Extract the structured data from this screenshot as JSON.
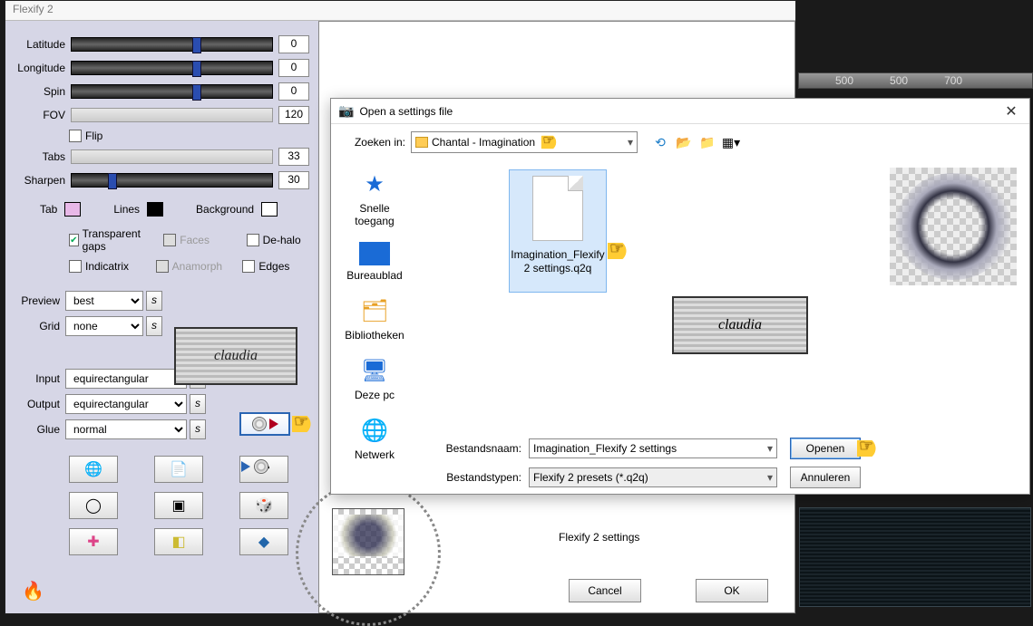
{
  "flexify": {
    "title": "Flexify 2",
    "sliders": {
      "latitude": {
        "label": "Latitude",
        "value": "0"
      },
      "longitude": {
        "label": "Longitude",
        "value": "0"
      },
      "spin": {
        "label": "Spin",
        "value": "0"
      },
      "fov": {
        "label": "FOV",
        "value": "120"
      },
      "tabs": {
        "label": "Tabs",
        "value": "33"
      },
      "sharpen": {
        "label": "Sharpen",
        "value": "30"
      }
    },
    "flip_label": "Flip",
    "swatches": {
      "tab": "Tab",
      "lines": "Lines",
      "background": "Background"
    },
    "checks": {
      "transparent": "Transparent gaps",
      "faces": "Faces",
      "dehalo": "De-halo",
      "indicatrix": "Indicatrix",
      "anamorph": "Anamorph",
      "edges": "Edges"
    },
    "selects": {
      "preview": {
        "label": "Preview",
        "value": "best"
      },
      "grid": {
        "label": "Grid",
        "value": "none"
      },
      "input": {
        "label": "Input",
        "value": "equirectangular"
      },
      "output": {
        "label": "Output",
        "value": "equirectangular"
      },
      "glue": {
        "label": "Glue",
        "value": "normal"
      }
    },
    "s_button": "s",
    "logo": "claudia",
    "settings_label": "Flexify 2 settings",
    "buttons": {
      "cancel": "Cancel",
      "ok": "OK"
    }
  },
  "fileopen": {
    "title": "Open a settings file",
    "search_in_label": "Zoeken in:",
    "folder_name": "Chantal - Imagination",
    "places": {
      "quick": "Snelle toegang",
      "desktop": "Bureaublad",
      "libraries": "Bibliotheken",
      "thispc": "Deze pc",
      "network": "Netwerk"
    },
    "file_item": {
      "line1": "Imagination_Flexify",
      "line2": "2 settings.q2q"
    },
    "logo": "claudia",
    "filename_label": "Bestandsnaam:",
    "filename_value": "Imagination_Flexify 2 settings",
    "filetype_label": "Bestandstypen:",
    "filetype_value": "Flexify 2 presets (*.q2q)",
    "open_btn": "Openen",
    "cancel_btn": "Annuleren"
  },
  "ruler": {
    "t1": "500",
    "t2": "500",
    "t3": "700"
  }
}
